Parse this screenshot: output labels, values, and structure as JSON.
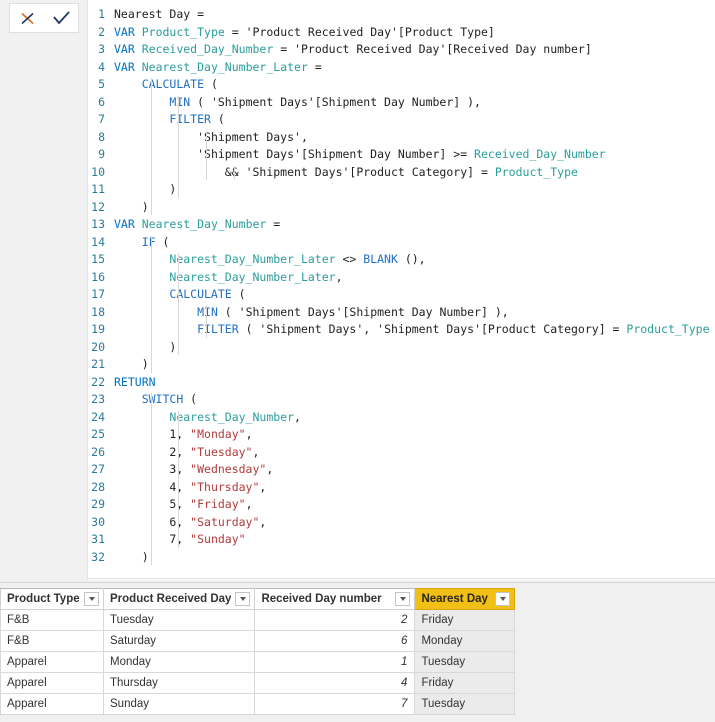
{
  "formula_bar": {
    "cancel_label": "Cancel",
    "commit_label": "Commit",
    "cancel_icon": "close-icon",
    "commit_icon": "checkmark-icon",
    "cancel_color": "#D96A1F",
    "commit_color": "#1F3864"
  },
  "editor": {
    "language": "DAX",
    "measure_name": "Nearest Day",
    "colors": {
      "keyword": "#0070C0",
      "function": "#1F6FC4",
      "variable": "#2B9D9D",
      "string": "#B23A3A",
      "plain": "#1F1F1F",
      "line_number": "#2B7A99",
      "background": "#FFFFFF",
      "gutter": "#F1F1F1"
    },
    "lines": [
      {
        "n": "1",
        "text": "Nearest Day ="
      },
      {
        "n": "2",
        "text": "VAR Product_Type = 'Product Received Day'[Product Type]"
      },
      {
        "n": "3",
        "text": "VAR Received_Day_Number = 'Product Received Day'[Received Day number]"
      },
      {
        "n": "4",
        "text": "VAR Nearest_Day_Number_Later ="
      },
      {
        "n": "5",
        "text": "    CALCULATE ("
      },
      {
        "n": "6",
        "text": "        MIN ( 'Shipment Days'[Shipment Day Number] ),"
      },
      {
        "n": "7",
        "text": "        FILTER ("
      },
      {
        "n": "8",
        "text": "            'Shipment Days',"
      },
      {
        "n": "9",
        "text": "            'Shipment Days'[Shipment Day Number] >= Received_Day_Number"
      },
      {
        "n": "10",
        "text": "                && 'Shipment Days'[Product Category] = Product_Type"
      },
      {
        "n": "11",
        "text": "        )"
      },
      {
        "n": "12",
        "text": "    )"
      },
      {
        "n": "13",
        "text": "VAR Nearest_Day_Number ="
      },
      {
        "n": "14",
        "text": "    IF ("
      },
      {
        "n": "15",
        "text": "        Nearest_Day_Number_Later <> BLANK (),"
      },
      {
        "n": "16",
        "text": "        Nearest_Day_Number_Later,"
      },
      {
        "n": "17",
        "text": "        CALCULATE ("
      },
      {
        "n": "18",
        "text": "            MIN ( 'Shipment Days'[Shipment Day Number] ),"
      },
      {
        "n": "19",
        "text": "            FILTER ( 'Shipment Days', 'Shipment Days'[Product Category] = Product_Type )"
      },
      {
        "n": "20",
        "text": "        )"
      },
      {
        "n": "21",
        "text": "    )"
      },
      {
        "n": "22",
        "text": "RETURN"
      },
      {
        "n": "23",
        "text": "    SWITCH ("
      },
      {
        "n": "24",
        "text": "        Nearest_Day_Number,"
      },
      {
        "n": "25",
        "text": "        1, \"Monday\","
      },
      {
        "n": "26",
        "text": "        2, \"Tuesday\","
      },
      {
        "n": "27",
        "text": "        3, \"Wednesday\","
      },
      {
        "n": "28",
        "text": "        4, \"Thursday\","
      },
      {
        "n": "29",
        "text": "        5, \"Friday\","
      },
      {
        "n": "30",
        "text": "        6, \"Saturday\","
      },
      {
        "n": "31",
        "text": "        7, \"Sunday\""
      },
      {
        "n": "32",
        "text": "    )"
      }
    ]
  },
  "preview_table": {
    "selected_column": "Nearest Day",
    "selected_header_color": "#F2C014",
    "columns": [
      {
        "label": "Product Type",
        "align": "left"
      },
      {
        "label": "Product Received Day",
        "align": "left"
      },
      {
        "label": "Received Day number",
        "align": "right"
      },
      {
        "label": "Nearest Day",
        "align": "left"
      }
    ],
    "rows": [
      {
        "product_type": "F&B",
        "product_received_day": "Tuesday",
        "received_day_number": "2",
        "nearest_day": "Friday"
      },
      {
        "product_type": "F&B",
        "product_received_day": "Saturday",
        "received_day_number": "6",
        "nearest_day": "Monday"
      },
      {
        "product_type": "Apparel",
        "product_received_day": "Monday",
        "received_day_number": "1",
        "nearest_day": "Tuesday"
      },
      {
        "product_type": "Apparel",
        "product_received_day": "Thursday",
        "received_day_number": "4",
        "nearest_day": "Friday"
      },
      {
        "product_type": "Apparel",
        "product_received_day": "Sunday",
        "received_day_number": "7",
        "nearest_day": "Tuesday"
      }
    ],
    "filter_icon": "chevron-down-icon"
  }
}
